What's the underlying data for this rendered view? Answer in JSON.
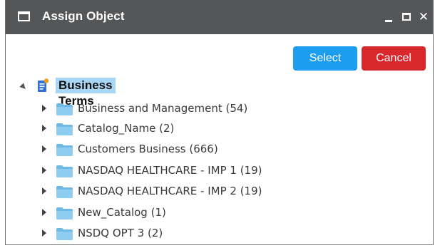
{
  "window": {
    "title": "Assign Object",
    "icons": {
      "window": "window-icon",
      "minimize": "minimize-icon",
      "maximize": "maximize-icon",
      "close": "close-icon"
    },
    "close_glyph": "✕"
  },
  "actions": {
    "select_label": "Select",
    "cancel_label": "Cancel"
  },
  "colors": {
    "titlebar": "#545658",
    "select": "#1c9ef0",
    "cancel": "#d9282d",
    "selection": "#a9d6f5",
    "folder": "#7fc4ea"
  },
  "tree": {
    "root": {
      "label": "Business Terms",
      "icon": "document-icon",
      "expanded": true
    },
    "children": [
      {
        "label": "Business and Management (54)",
        "icon": "folder-icon"
      },
      {
        "label": "Catalog_Name (2)",
        "icon": "folder-icon"
      },
      {
        "label": "Customers Business (666)",
        "icon": "folder-icon"
      },
      {
        "label": "NASDAQ HEALTHCARE - IMP 1 (19)",
        "icon": "folder-icon"
      },
      {
        "label": "NASDAQ HEALTHCARE - IMP 2 (19)",
        "icon": "folder-icon"
      },
      {
        "label": "New_Catalog (1)",
        "icon": "folder-icon"
      },
      {
        "label": "NSDQ OPT 3 (2)",
        "icon": "folder-icon"
      }
    ]
  }
}
